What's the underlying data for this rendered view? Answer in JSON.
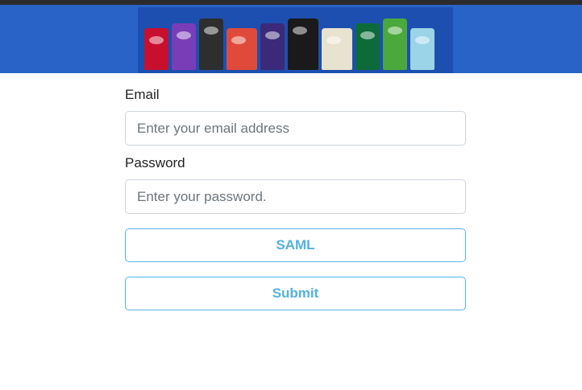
{
  "banner": {
    "bag_colors": [
      "#c8102e",
      "#7a3db8",
      "#2e2e2e",
      "#e04a3a",
      "#3b2a7a",
      "#1a1a1a",
      "#e8e2d0",
      "#0d6b3a",
      "#4aa83c",
      "#9bd4e8"
    ]
  },
  "form": {
    "email_label": "Email",
    "email_placeholder": "Enter your email address",
    "email_value": "",
    "password_label": "Password",
    "password_placeholder": "Enter your password.",
    "password_value": "",
    "saml_label": "SAML",
    "submit_label": "Submit"
  },
  "colors": {
    "header": "#2a63c8",
    "button_border": "#58b4e4",
    "button_text": "#55b0e3"
  }
}
